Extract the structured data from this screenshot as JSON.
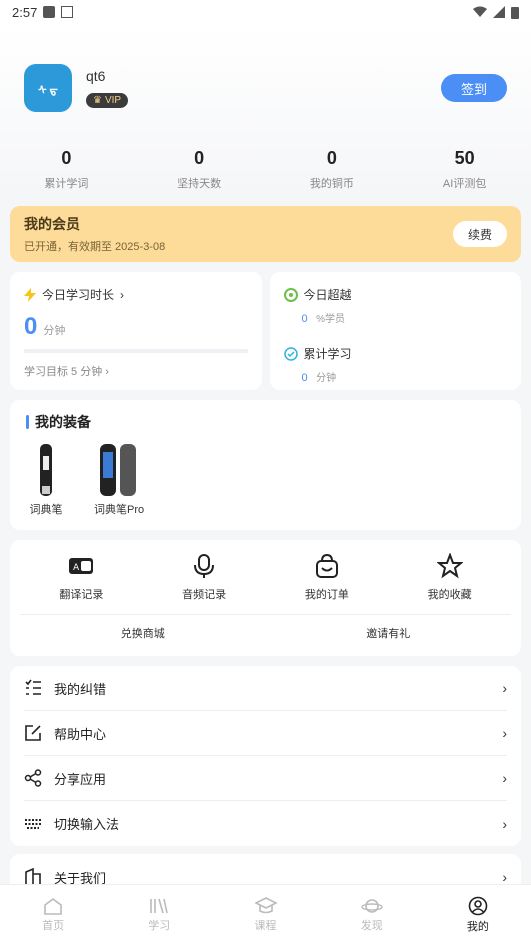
{
  "status": {
    "time": "2:57"
  },
  "profile": {
    "name": "qt6",
    "vip_label": "VIP",
    "signin_label": "签到",
    "avatar_text": "ᠰ ᠳ"
  },
  "stats": [
    {
      "value": "0",
      "label": "累计学词"
    },
    {
      "value": "0",
      "label": "坚持天数"
    },
    {
      "value": "0",
      "label": "我的铜币"
    },
    {
      "value": "50",
      "label": "AI评测包"
    }
  ],
  "membership": {
    "title": "我的会员",
    "subtitle": "已开通，有效期至 2025-3-08",
    "renew_label": "续费"
  },
  "today": {
    "title": "今日学习时长",
    "value": "0",
    "unit": "分钟",
    "goal": "学习目标 5 分钟",
    "progress": 0
  },
  "beyond": {
    "title": "今日超越",
    "value": "0",
    "unit": "%学员"
  },
  "cumulative": {
    "title": "累计学习",
    "value": "0",
    "unit": "分钟"
  },
  "equipment": {
    "title": "我的装备",
    "devices": [
      {
        "label": "词典笔"
      },
      {
        "label": "词典笔Pro"
      }
    ]
  },
  "grid": [
    {
      "label": "翻译记录",
      "icon": "translate-icon"
    },
    {
      "label": "音频记录",
      "icon": "microphone-icon"
    },
    {
      "label": "我的订单",
      "icon": "order-bag-icon"
    },
    {
      "label": "我的收藏",
      "icon": "star-icon"
    }
  ],
  "sublinks": [
    {
      "label": "兑换商城"
    },
    {
      "label": "邀请有礼"
    }
  ],
  "menu": [
    {
      "label": "我的纠错",
      "icon": "checklist-icon"
    },
    {
      "label": "帮助中心",
      "icon": "edit-icon"
    },
    {
      "label": "分享应用",
      "icon": "share-icon"
    },
    {
      "label": "切换输入法",
      "icon": "keyboard-icon"
    }
  ],
  "about": {
    "label": "关于我们",
    "icon": "building-icon"
  },
  "tabs": [
    {
      "label": "首页",
      "icon": "home-icon"
    },
    {
      "label": "学习",
      "icon": "books-icon"
    },
    {
      "label": "课程",
      "icon": "graduation-cap-icon"
    },
    {
      "label": "发现",
      "icon": "planet-icon"
    },
    {
      "label": "我的",
      "icon": "user-circle-icon"
    }
  ],
  "colors": {
    "accent": "#4b8ef5",
    "member_bg": "#fddb99"
  }
}
